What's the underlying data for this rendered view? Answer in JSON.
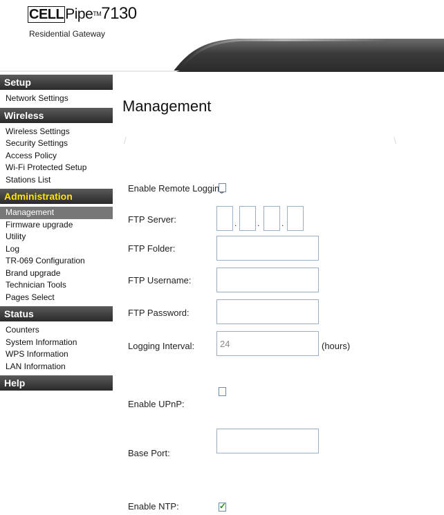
{
  "header": {
    "logo_brand_cell": "CELL",
    "logo_brand_pipe": "Pipe",
    "logo_tm": "TM",
    "logo_model": "7130",
    "logo_subtitle": "Residential Gateway"
  },
  "sidebar": {
    "sections": [
      {
        "title": "Setup",
        "items": [
          "Network Settings"
        ]
      },
      {
        "title": "Wireless",
        "items": [
          "Wireless Settings",
          "Security Settings",
          "Access Policy",
          "Wi-Fi Protected Setup",
          "Stations List"
        ]
      },
      {
        "title": "Administration",
        "items": [
          "Management",
          "Firmware upgrade",
          "Utility",
          "Log",
          "TR-069 Configuration",
          "Brand upgrade",
          "Technician Tools",
          "Pages Select"
        ]
      },
      {
        "title": "Status",
        "items": [
          "Counters",
          "System Information",
          "WPS Information",
          "LAN Information"
        ]
      },
      {
        "title": "Help",
        "items": []
      }
    ],
    "active_section": "Administration",
    "selected_item": "Management"
  },
  "main": {
    "title": "Management",
    "remote_logging_label": "Enable Remote Logging:",
    "remote_logging_checked": false,
    "ftp_server_label": "FTP Server:",
    "ftp_server_octets": [
      "",
      "",
      "",
      ""
    ],
    "ftp_folder_label": "FTP Folder:",
    "ftp_folder_value": "",
    "ftp_username_label": "FTP Username:",
    "ftp_username_value": "",
    "ftp_password_label": "FTP Password:",
    "ftp_password_value": "",
    "logging_interval_label": "Logging Interval:",
    "logging_interval_value": "24",
    "logging_interval_unit": "(hours)",
    "upnp_label": "Enable UPnP:",
    "upnp_checked": false,
    "base_port_label": "Base Port:",
    "base_port_value": "",
    "ntp_label": "Enable NTP:",
    "ntp_checked": true
  },
  "colors": {
    "section_header_bg": "#3a3a3a",
    "section_header_active_text": "#ffe600",
    "selected_item_bg": "#777777",
    "input_border": "#9ab0c8",
    "check_mark": "#1a8a1a"
  }
}
